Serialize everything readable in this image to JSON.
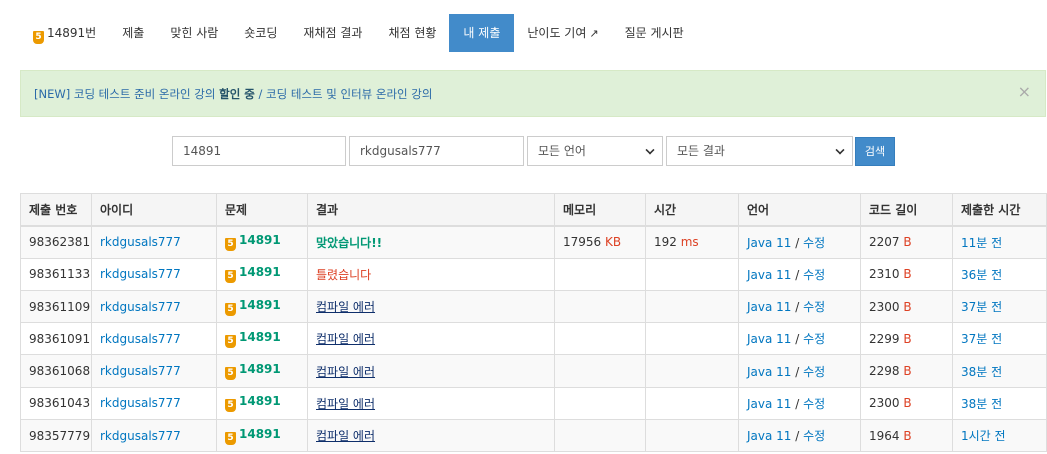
{
  "tabs": [
    {
      "label": "14891번",
      "tier_badge": "5",
      "active": false
    },
    {
      "label": "제출",
      "active": false
    },
    {
      "label": "맞힌 사람",
      "active": false
    },
    {
      "label": "숏코딩",
      "active": false
    },
    {
      "label": "재채점 결과",
      "active": false
    },
    {
      "label": "채점 현황",
      "active": false
    },
    {
      "label": "내 제출",
      "active": true
    },
    {
      "label": "난이도 기여",
      "icon": "external-link-icon",
      "active": false
    },
    {
      "label": "질문 게시판",
      "active": false
    }
  ],
  "alert": {
    "prefix": "[NEW] 코딩 테스트 준비 온라인 강의 ",
    "bold": "할인 중",
    "suffix": " / 코딩 테스트 및 인터뷰 온라인 강의",
    "close": "×"
  },
  "search": {
    "problem_value": "14891",
    "user_value": "rkdgusals777",
    "language_selected": "모든 언어",
    "result_selected": "모든 결과",
    "button_label": "검색"
  },
  "table": {
    "headers": [
      "제출 번호",
      "아이디",
      "문제",
      "결과",
      "메모리",
      "시간",
      "언어",
      "코드 길이",
      "제출한 시간"
    ],
    "rows": [
      {
        "id": "98362381",
        "user": "rkdgusals777",
        "tier": "5",
        "problem": "14891",
        "result": "맞았습니다!!",
        "result_type": "ac",
        "memory": "17956",
        "memory_unit": "KB",
        "time": "192",
        "time_unit": "ms",
        "lang": "Java 11",
        "edit": "수정",
        "len": "2207",
        "len_unit": "B",
        "when": "11분 전"
      },
      {
        "id": "98361133",
        "user": "rkdgusals777",
        "tier": "5",
        "problem": "14891",
        "result": "틀렸습니다",
        "result_type": "wa",
        "memory": "",
        "memory_unit": "",
        "time": "",
        "time_unit": "",
        "lang": "Java 11",
        "edit": "수정",
        "len": "2310",
        "len_unit": "B",
        "when": "36분 전"
      },
      {
        "id": "98361109",
        "user": "rkdgusals777",
        "tier": "5",
        "problem": "14891",
        "result": "컴파일 에러",
        "result_type": "ce",
        "memory": "",
        "memory_unit": "",
        "time": "",
        "time_unit": "",
        "lang": "Java 11",
        "edit": "수정",
        "len": "2300",
        "len_unit": "B",
        "when": "37분 전"
      },
      {
        "id": "98361091",
        "user": "rkdgusals777",
        "tier": "5",
        "problem": "14891",
        "result": "컴파일 에러",
        "result_type": "ce",
        "memory": "",
        "memory_unit": "",
        "time": "",
        "time_unit": "",
        "lang": "Java 11",
        "edit": "수정",
        "len": "2299",
        "len_unit": "B",
        "when": "37분 전"
      },
      {
        "id": "98361068",
        "user": "rkdgusals777",
        "tier": "5",
        "problem": "14891",
        "result": "컴파일 에러",
        "result_type": "ce",
        "memory": "",
        "memory_unit": "",
        "time": "",
        "time_unit": "",
        "lang": "Java 11",
        "edit": "수정",
        "len": "2298",
        "len_unit": "B",
        "when": "38분 전"
      },
      {
        "id": "98361043",
        "user": "rkdgusals777",
        "tier": "5",
        "problem": "14891",
        "result": "컴파일 에러",
        "result_type": "ce",
        "memory": "",
        "memory_unit": "",
        "time": "",
        "time_unit": "",
        "lang": "Java 11",
        "edit": "수정",
        "len": "2300",
        "len_unit": "B",
        "when": "38분 전"
      },
      {
        "id": "98357779",
        "user": "rkdgusals777",
        "tier": "5",
        "problem": "14891",
        "result": "컴파일 에러",
        "result_type": "ce",
        "memory": "",
        "memory_unit": "",
        "time": "",
        "time_unit": "",
        "lang": "Java 11",
        "edit": "수정",
        "len": "1964",
        "len_unit": "B",
        "when": "1시간 전"
      }
    ]
  },
  "colors": {
    "accent": "#428bca",
    "ac": "#009874",
    "wa": "#dd4124",
    "link": "#0076c0",
    "tier_bronze": "#ec9a00"
  }
}
